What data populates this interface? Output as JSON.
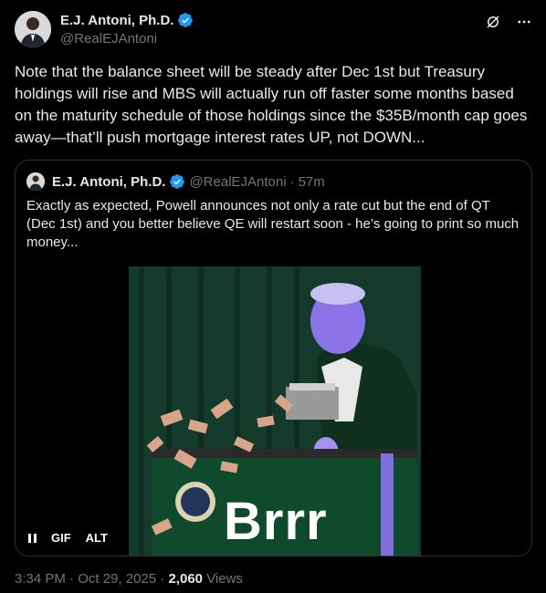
{
  "tweet": {
    "author_name": "E.J. Antoni, Ph.D.",
    "author_handle": "@RealEJAntoni",
    "text": "Note that the balance sheet will be steady after Dec 1st but Treasury holdings will rise and MBS will actually run off faster some months based on the maturity schedule of those holdings since the $35B/month cap goes away—that’ll push mortgage interest rates UP, not DOWN...",
    "time": "3:34 PM",
    "date": "Oct 29, 2025",
    "views_count": "2,060",
    "views_label": "Views",
    "dot": "·"
  },
  "quote": {
    "author_name": "E.J. Antoni, Ph.D.",
    "author_handle": "@RealEJAntoni",
    "age": "57m",
    "dot": "·",
    "text": "Exactly as expected, Powell announces not only a rate cut but the end of QT (Dec 1st) and you better believe QE will restart soon - he’s going to print so much money..."
  },
  "media": {
    "caption": "Brrr",
    "gif_label": "GIF",
    "alt_label": "ALT"
  },
  "icons": {
    "verified": "verified-badge-icon",
    "grok": "grok-icon",
    "more": "more-icon",
    "pause": "pause-icon"
  },
  "colors": {
    "background": "#000000",
    "text": "#e7e9ea",
    "muted": "#71767b",
    "verified": "#1d9bf0",
    "border": "#2f3336"
  }
}
